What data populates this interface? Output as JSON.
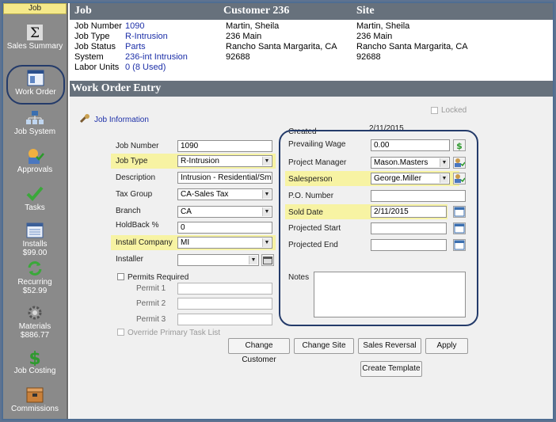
{
  "sidebar": {
    "title": "Job",
    "items": [
      {
        "label": "Sales Summary",
        "icon": "sigma-icon"
      },
      {
        "label": "Work Order",
        "icon": "work-order-icon"
      },
      {
        "label": "Job System",
        "icon": "job-system-icon"
      },
      {
        "label": "Approvals",
        "icon": "approvals-icon"
      },
      {
        "label": "Tasks",
        "icon": "checkmark-icon"
      },
      {
        "label": "Installs",
        "sub": "$99.00",
        "icon": "installs-icon"
      },
      {
        "label": "Recurring",
        "sub": "$52.99",
        "icon": "recurring-icon"
      },
      {
        "label": "Materials",
        "sub": "$886.77",
        "icon": "gear-icon"
      },
      {
        "label": "Job Costing",
        "icon": "dollar-icon"
      },
      {
        "label": "Commissions",
        "icon": "commissions-icon"
      }
    ]
  },
  "header": {
    "job_title": "Job",
    "customer_title": "Customer 236",
    "site_title": "Site",
    "fields": [
      {
        "key": "Job Number",
        "value": "1090"
      },
      {
        "key": "Job Type",
        "value": "R-Intrusion"
      },
      {
        "key": "Job Status",
        "value": "Parts"
      },
      {
        "key": "System",
        "value": "236-int Intrusion"
      },
      {
        "key": "Labor Units",
        "value": "0 (8 Used)"
      }
    ],
    "customer": [
      "Martin, Sheila",
      "236 Main",
      "Rancho Santa Margarita, CA",
      "92688"
    ],
    "site": [
      "Martin, Sheila",
      "236 Main",
      "Rancho Santa Margarita, CA",
      "92688"
    ]
  },
  "work_order": {
    "title": "Work Order Entry",
    "locked_label": "Locked",
    "job_info_label": "Job Information",
    "created_label": "Created",
    "created_value": "2/11/2015",
    "left": {
      "job_number_label": "Job Number",
      "job_number": "1090",
      "job_type_label": "Job Type",
      "job_type": "R-Intrusion",
      "description_label": "Description",
      "description": "Intrusion - Residential/Small Co",
      "tax_group_label": "Tax Group",
      "tax_group": "CA-Sales Tax",
      "branch_label": "Branch",
      "branch": "CA",
      "holdback_label": "HoldBack  %",
      "holdback": "0",
      "install_company_label": "Install Company",
      "install_company": "MI",
      "installer_label": "Installer",
      "installer": "",
      "permits_required_label": "Permits Required",
      "permit1_label": "Permit 1",
      "permit2_label": "Permit 2",
      "permit3_label": "Permit 3",
      "override_label": "Override Primary Task List"
    },
    "right": {
      "prevailing_wage_label": "Prevailing Wage",
      "prevailing_wage": "0.00",
      "project_manager_label": "Project Manager",
      "project_manager": "Mason.Masters",
      "salesperson_label": "Salesperson",
      "salesperson": "George.Miller",
      "po_number_label": "P.O. Number",
      "po_number": "",
      "sold_date_label": "Sold Date",
      "sold_date": "2/11/2015",
      "projected_start_label": "Projected Start",
      "projected_start": "",
      "projected_end_label": "Projected End",
      "projected_end": "",
      "notes_label": "Notes"
    },
    "buttons": {
      "change_customer": "Change Customer",
      "change_site": "Change Site",
      "sales_reversal": "Sales Reversal",
      "apply": "Apply",
      "create_template": "Create Template"
    }
  },
  "colors": {
    "highlight": "#f7f3a3",
    "header_bar": "#67717c",
    "link_blue": "#1c2fa8",
    "callout": "#243b6a"
  }
}
